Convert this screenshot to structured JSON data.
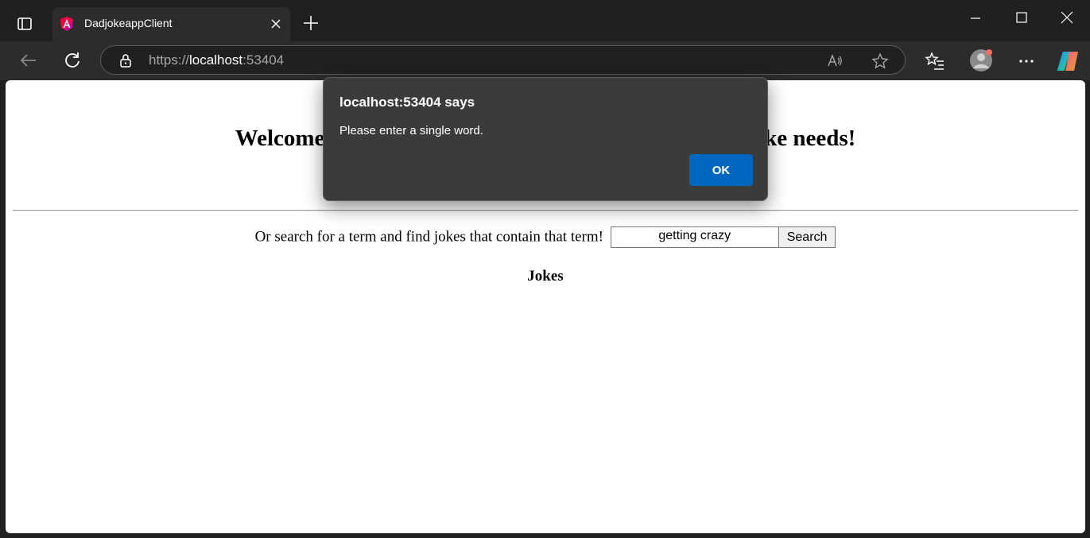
{
  "browser": {
    "tab": {
      "title": "DadjokeappClient"
    },
    "url": {
      "scheme": "https://",
      "host": "localhost",
      "port": ":53404"
    },
    "icons": {
      "tab_actions": "sidebar-panel-icon",
      "favicon": "angular-logo-icon",
      "tab_close": "close-icon",
      "new_tab": "plus-icon",
      "back": "arrow-left-icon",
      "refresh": "refresh-icon",
      "lock": "lock-icon",
      "read_aloud": "read-aloud-icon",
      "favorite": "star-icon",
      "favorites": "favorites-list-icon",
      "profile": "avatar-icon",
      "more": "more-icon",
      "copilot": "copilot-icon"
    },
    "colors": {
      "accent": "#0067c0",
      "frame": "#202020",
      "toolbar": "#2c2c2c"
    }
  },
  "page": {
    "welcome": "Welcome to the dad joke app. Here for all your dad joke needs!",
    "search_label": "Or search for a term and find jokes that contain that term!",
    "search_value": "getting crazy",
    "search_button": "Search",
    "jokes_heading": "Jokes"
  },
  "dialog": {
    "title": "localhost:53404 says",
    "message": "Please enter a single word.",
    "ok_label": "OK"
  }
}
